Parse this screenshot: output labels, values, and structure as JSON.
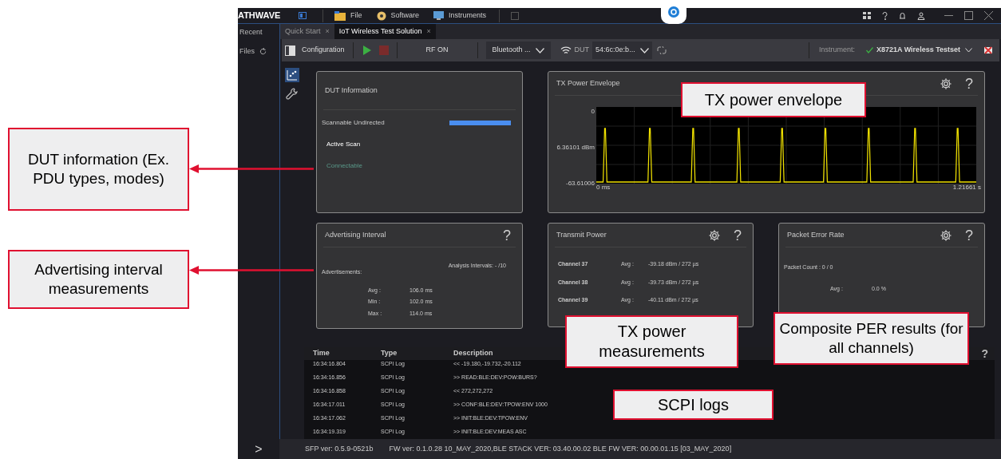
{
  "app": {
    "logo": "ATHWAVE",
    "menu": [
      {
        "label": "File",
        "kind": "folder"
      },
      {
        "label": "Software",
        "kind": "disc"
      },
      {
        "label": "Instruments",
        "kind": "monitor"
      }
    ]
  },
  "sidebar": {
    "items": [
      {
        "label": "Recent",
        "refresh": false
      },
      {
        "label": "Files",
        "refresh": true
      }
    ],
    "expand": ">"
  },
  "tabs": [
    {
      "label": "Quick Start",
      "close": "×",
      "selected": false
    },
    {
      "label": "IoT Wireless Test Solution",
      "close": "×",
      "selected": true
    }
  ],
  "toolbar": {
    "configuration": "Configuration",
    "rf": "RF ON",
    "protocol": "Bluetooth ...",
    "dut_label": "DUT",
    "dut_value": "54:6c:0e:b...",
    "instrument_label": "Instrument:",
    "instrument": "X8721A Wireless Testset",
    "connected": true
  },
  "dut_info": {
    "title": "DUT Information",
    "rows": [
      {
        "label": "Scannable Undirected",
        "kind": "bar"
      },
      {
        "label": "Active Scan",
        "kind": "on"
      },
      {
        "label": "Connectable",
        "kind": "dim"
      }
    ]
  },
  "tx_envelope": {
    "title": "TX Power Envelope",
    "help": "?",
    "y_tick_labels": [
      "0",
      "6.36101 dBm",
      "-63.61006"
    ],
    "x_tick_labels": [
      "0 ms",
      "1.21661 s"
    ]
  },
  "advertising": {
    "title": "Advertising Interval",
    "help": "?",
    "analysis": "Analysis Intervals: - /10",
    "label": "Advertisements:",
    "stats": [
      {
        "name": "Avg :",
        "value": "106.0 ms"
      },
      {
        "name": "Min :",
        "value": "102.0 ms"
      },
      {
        "name": "Max :",
        "value": "114.0 ms"
      }
    ]
  },
  "transmit_power": {
    "title": "Transmit Power",
    "help": "?",
    "rows": [
      {
        "channel": "Channel 37",
        "name": "Avg :",
        "value": "-39.18 dBm / 272 µs"
      },
      {
        "channel": "Channel 38",
        "name": "Avg :",
        "value": "-39.73 dBm / 272 µs"
      },
      {
        "channel": "Channel 39",
        "name": "Avg :",
        "value": "-40.11 dBm / 272 µs"
      }
    ]
  },
  "per": {
    "title": "Packet Error Rate",
    "help": "?",
    "count": "Packet Count : 0 / 0",
    "name": "Avg :",
    "value": "0.0 %"
  },
  "log": {
    "columns": [
      "Time",
      "Type",
      "Description"
    ],
    "help": "?",
    "rows": [
      [
        "16:34:16.804",
        "SCPI Log",
        "<< -19.180,-19.732,-20.112"
      ],
      [
        "16:34:16.856",
        "SCPI Log",
        ">> READ:BLE:DEV:POW:BURS?"
      ],
      [
        "16:34:16.858",
        "SCPI Log",
        "<< 272,272,272"
      ],
      [
        "16:34:17.011",
        "SCPI Log",
        ">> CONF:BLE:DEV:TPOW:ENV 1000"
      ],
      [
        "16:34:17.062",
        "SCPI Log",
        ">> INIT:BLE:DEV:TPOW:ENV"
      ],
      [
        "16:34:19.319",
        "SCPI Log",
        ">> INIT:BLE:DEV:MEAS ASC"
      ]
    ]
  },
  "status_bar": [
    "SFP ver: 0.5.9-0521b",
    "FW ver: 0.1.0.28 10_MAY_2020,BLE STACK VER: 03.40.00.02 BLE FW VER: 00.00.01.15 [03_MAY_2020]"
  ],
  "callouts": [
    {
      "text": "DUT information (Ex. PDU types, modes)"
    },
    {
      "text": "Advertising interval measurements"
    },
    {
      "text": "TX power envelope"
    },
    {
      "text": "TX power measurements"
    },
    {
      "text": "Composite PER results (for all channels)"
    },
    {
      "text": "SCPI logs"
    }
  ]
}
